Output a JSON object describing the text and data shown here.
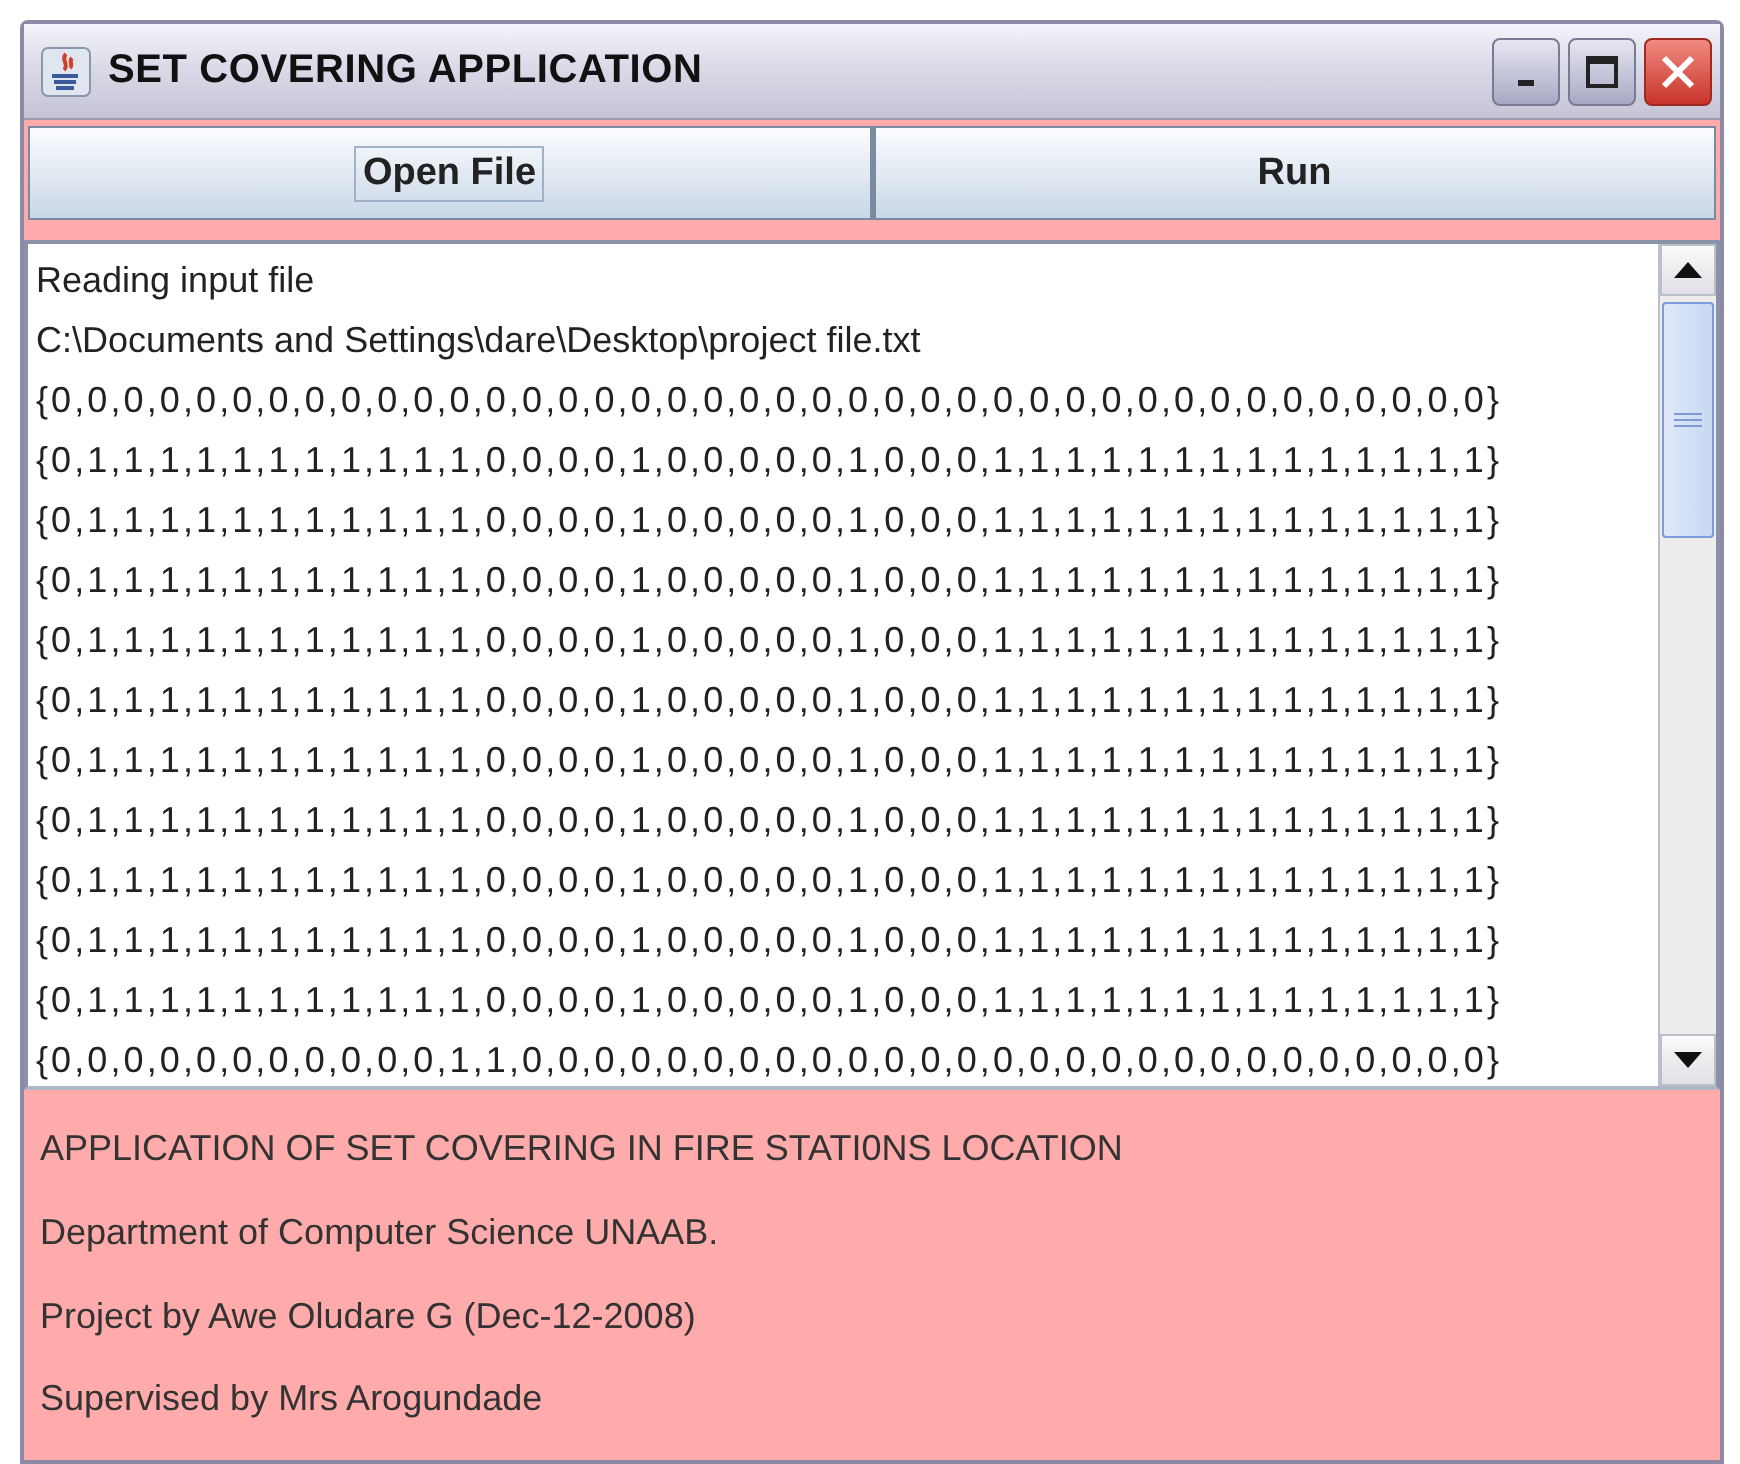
{
  "window": {
    "title": "SET COVERING APPLICATION"
  },
  "toolbar": {
    "buttons": [
      {
        "label": "Open File",
        "focused": true
      },
      {
        "label": "Run",
        "focused": false
      }
    ]
  },
  "output": {
    "lines": [
      "Reading input file",
      "C:\\Documents and Settings\\dare\\Desktop\\project file.txt",
      "{0,0,0,0,0,0,0,0,0,0,0,0,0,0,0,0,0,0,0,0,0,0,0,0,0,0,0,0,0,0,0,0,0,0,0,0,0,0,0,0}",
      "{0,1,1,1,1,1,1,1,1,1,1,1,0,0,0,0,1,0,0,0,0,0,1,0,0,0,1,1,1,1,1,1,1,1,1,1,1,1,1,1}",
      "{0,1,1,1,1,1,1,1,1,1,1,1,0,0,0,0,1,0,0,0,0,0,1,0,0,0,1,1,1,1,1,1,1,1,1,1,1,1,1,1}",
      "{0,1,1,1,1,1,1,1,1,1,1,1,0,0,0,0,1,0,0,0,0,0,1,0,0,0,1,1,1,1,1,1,1,1,1,1,1,1,1,1}",
      "{0,1,1,1,1,1,1,1,1,1,1,1,0,0,0,0,1,0,0,0,0,0,1,0,0,0,1,1,1,1,1,1,1,1,1,1,1,1,1,1}",
      "{0,1,1,1,1,1,1,1,1,1,1,1,0,0,0,0,1,0,0,0,0,0,1,0,0,0,1,1,1,1,1,1,1,1,1,1,1,1,1,1}",
      "{0,1,1,1,1,1,1,1,1,1,1,1,0,0,0,0,1,0,0,0,0,0,1,0,0,0,1,1,1,1,1,1,1,1,1,1,1,1,1,1}",
      "{0,1,1,1,1,1,1,1,1,1,1,1,0,0,0,0,1,0,0,0,0,0,1,0,0,0,1,1,1,1,1,1,1,1,1,1,1,1,1,1}",
      "{0,1,1,1,1,1,1,1,1,1,1,1,0,0,0,0,1,0,0,0,0,0,1,0,0,0,1,1,1,1,1,1,1,1,1,1,1,1,1,1}",
      "{0,1,1,1,1,1,1,1,1,1,1,1,0,0,0,0,1,0,0,0,0,0,1,0,0,0,1,1,1,1,1,1,1,1,1,1,1,1,1,1}",
      "{0,1,1,1,1,1,1,1,1,1,1,1,0,0,0,0,1,0,0,0,0,0,1,0,0,0,1,1,1,1,1,1,1,1,1,1,1,1,1,1}",
      "{0,0,0,0,0,0,0,0,0,0,0,1,1,0,0,0,0,0,0,0,0,0,0,0,0,0,0,0,0,0,0,0,0,0,0,0,0,0,0,0}"
    ]
  },
  "footer": {
    "lines": [
      "APPLICATION OF SET COVERING IN FIRE STATI0NS LOCATION",
      "Department of Computer Science UNAAB.",
      "Project by Awe Oludare G (Dec-12-2008)",
      "Supervised by Mrs Arogundade"
    ]
  }
}
